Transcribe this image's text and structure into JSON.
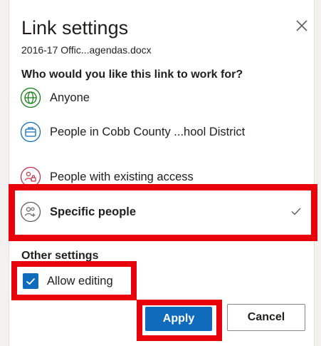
{
  "dialog": {
    "title": "Link settings",
    "file_name": "2016-17 Offic...agendas.docx"
  },
  "audience": {
    "question": "Who would you like this link to work for?",
    "options": [
      {
        "label": "Anyone",
        "icon": "globe-icon",
        "color": "#107c10"
      },
      {
        "label": "People in Cobb County ...hool District",
        "icon": "briefcase-icon",
        "color": "#0f6cbd"
      },
      {
        "label": "People with existing access",
        "icon": "people-lock-icon",
        "color": "#c4314b"
      },
      {
        "label": "Specific people",
        "icon": "people-add-icon",
        "color": "#605e5c",
        "selected": true
      }
    ]
  },
  "other_settings": {
    "heading": "Other settings",
    "allow_editing_label": "Allow editing",
    "allow_editing_checked": true
  },
  "buttons": {
    "apply_label": "Apply",
    "cancel_label": "Cancel"
  },
  "colors": {
    "accent": "#0f6cbd",
    "highlight": "#e8000b"
  }
}
